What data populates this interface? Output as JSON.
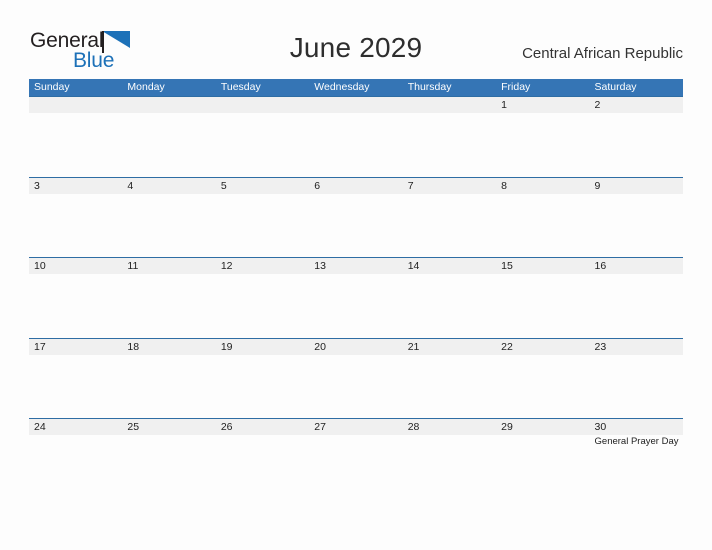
{
  "logo": {
    "word_one": "General",
    "word_two": "Blue",
    "flag_icon": "blue-triangle-flag-icon",
    "color_dark": "#231f20",
    "color_blue": "#1d71b8"
  },
  "header": {
    "title": "June 2029",
    "country": "Central African Republic"
  },
  "theme": {
    "header_blue": "#3575b5",
    "rule_blue": "#2e6da4",
    "band_gray": "#f0f0f0",
    "page_background": "#fdfdfd",
    "text_dark": "#222222"
  },
  "calendar": {
    "month": "June",
    "year": "2029",
    "weekdays": [
      "Sunday",
      "Monday",
      "Tuesday",
      "Wednesday",
      "Thursday",
      "Friday",
      "Saturday"
    ],
    "weeks": [
      {
        "days": [
          {
            "num": "",
            "event": ""
          },
          {
            "num": "",
            "event": ""
          },
          {
            "num": "",
            "event": ""
          },
          {
            "num": "",
            "event": ""
          },
          {
            "num": "",
            "event": ""
          },
          {
            "num": "1",
            "event": ""
          },
          {
            "num": "2",
            "event": ""
          }
        ]
      },
      {
        "days": [
          {
            "num": "3",
            "event": ""
          },
          {
            "num": "4",
            "event": ""
          },
          {
            "num": "5",
            "event": ""
          },
          {
            "num": "6",
            "event": ""
          },
          {
            "num": "7",
            "event": ""
          },
          {
            "num": "8",
            "event": ""
          },
          {
            "num": "9",
            "event": ""
          }
        ]
      },
      {
        "days": [
          {
            "num": "10",
            "event": ""
          },
          {
            "num": "11",
            "event": ""
          },
          {
            "num": "12",
            "event": ""
          },
          {
            "num": "13",
            "event": ""
          },
          {
            "num": "14",
            "event": ""
          },
          {
            "num": "15",
            "event": ""
          },
          {
            "num": "16",
            "event": ""
          }
        ]
      },
      {
        "days": [
          {
            "num": "17",
            "event": ""
          },
          {
            "num": "18",
            "event": ""
          },
          {
            "num": "19",
            "event": ""
          },
          {
            "num": "20",
            "event": ""
          },
          {
            "num": "21",
            "event": ""
          },
          {
            "num": "22",
            "event": ""
          },
          {
            "num": "23",
            "event": ""
          }
        ]
      },
      {
        "days": [
          {
            "num": "24",
            "event": ""
          },
          {
            "num": "25",
            "event": ""
          },
          {
            "num": "26",
            "event": ""
          },
          {
            "num": "27",
            "event": ""
          },
          {
            "num": "28",
            "event": ""
          },
          {
            "num": "29",
            "event": ""
          },
          {
            "num": "30",
            "event": "General Prayer Day"
          }
        ]
      }
    ]
  }
}
